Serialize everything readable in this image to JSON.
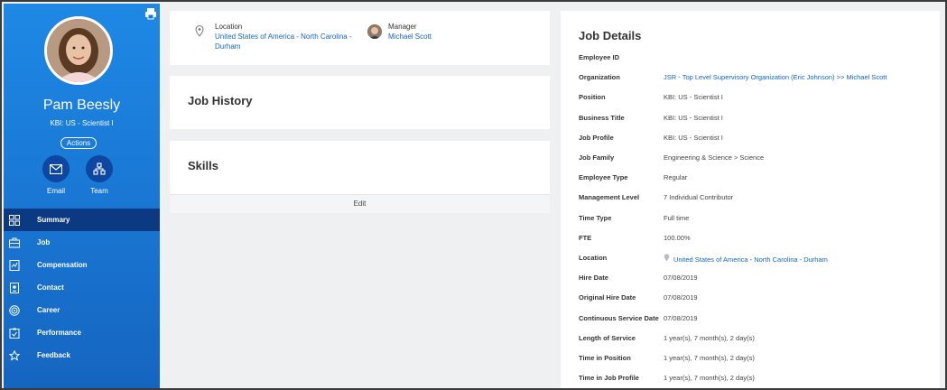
{
  "profile": {
    "name": "Pam Beesly",
    "title": "KBI: US - Scientist I",
    "actions_label": "Actions",
    "email_label": "Email",
    "team_label": "Team"
  },
  "nav": {
    "items": [
      {
        "label": "Summary",
        "icon": "summary-icon"
      },
      {
        "label": "Job",
        "icon": "job-icon"
      },
      {
        "label": "Compensation",
        "icon": "compensation-icon"
      },
      {
        "label": "Contact",
        "icon": "contact-icon"
      },
      {
        "label": "Career",
        "icon": "career-icon"
      },
      {
        "label": "Performance",
        "icon": "performance-icon"
      },
      {
        "label": "Feedback",
        "icon": "star-icon"
      }
    ]
  },
  "location_card": {
    "location_label": "Location",
    "location_value_line1": "United States of America - North Carolina -",
    "location_value_line2": "Durham",
    "manager_label": "Manager",
    "manager_value": "Michael Scott"
  },
  "job_history": {
    "title": "Job History"
  },
  "skills": {
    "title": "Skills",
    "edit_label": "Edit"
  },
  "job_details": {
    "title": "Job Details",
    "rows": [
      {
        "label": "Employee ID",
        "value": ""
      },
      {
        "label": "Organization",
        "value": "JSR - Top Level Supervisory Organization (Eric Johnson) >> Michael Scott"
      },
      {
        "label": "Position",
        "value": "KBI: US - Scientist I"
      },
      {
        "label": "Business Title",
        "value": "KBI: US - Scientist I"
      },
      {
        "label": "Job Profile",
        "value": "KBI: US - Scientist I"
      },
      {
        "label": "Job Family",
        "value": "Engineering & Science > Science"
      },
      {
        "label": "Employee Type",
        "value": "Regular"
      },
      {
        "label": "Management Level",
        "value": "7 Individual Contributor"
      },
      {
        "label": "Time Type",
        "value": "Full time"
      },
      {
        "label": "FTE",
        "value": "100.00%"
      },
      {
        "label": "Location",
        "value": "United States of America - North Carolina - Durham"
      },
      {
        "label": "Hire Date",
        "value": "07/08/2019"
      },
      {
        "label": "Original Hire Date",
        "value": "07/08/2019"
      },
      {
        "label": "Continuous Service Date",
        "value": "07/08/2019"
      },
      {
        "label": "Length of Service",
        "value": "1 year(s), 7 month(s), 2 day(s)"
      },
      {
        "label": "Time in Position",
        "value": "1 year(s), 7 month(s), 2 day(s)"
      },
      {
        "label": "Time in Job Profile",
        "value": "1 year(s), 7 month(s), 2 day(s)"
      }
    ]
  },
  "colors": {
    "sidebar_blue": "#1976d2",
    "nav_active": "#0b3a82",
    "link_blue": "#1565c0"
  }
}
